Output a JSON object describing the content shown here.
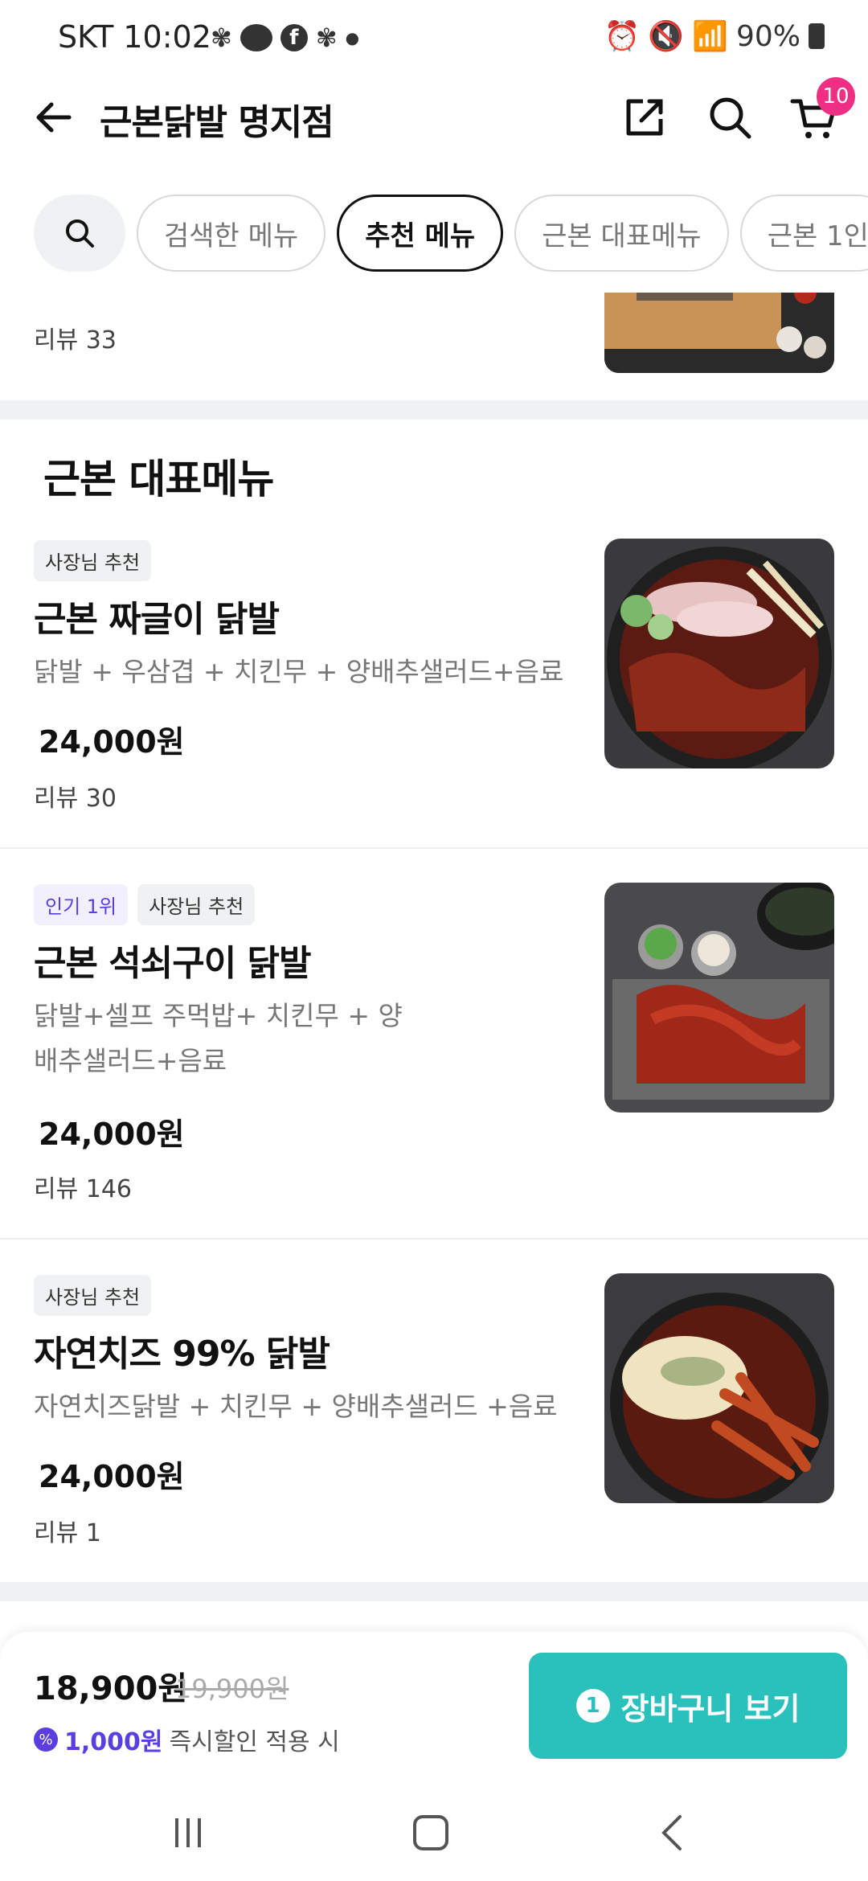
{
  "status_bar": {
    "time": "SKT 10:02",
    "talk_label": "TALK",
    "battery": "90%"
  },
  "header": {
    "title": "근본닭발 명지점",
    "cart_count": "10"
  },
  "tabs": [
    {
      "label": "검색한 메뉴",
      "active": false
    },
    {
      "label": "추천 메뉴",
      "active": true
    },
    {
      "label": "근본 대표메뉴",
      "active": false
    },
    {
      "label": "근본 1인",
      "active": false
    }
  ],
  "partial_item": {
    "review": "리뷰 33"
  },
  "section": {
    "title": "근본 대표메뉴"
  },
  "menu_items": [
    {
      "badges": [
        {
          "label": "사장님 추천",
          "type": "owner"
        }
      ],
      "name": "근본 짜글이 닭발",
      "desc": "닭발 + 우삼겹 + 치킨무 + 양배추샐러드+음료",
      "price": "24,000원",
      "review": "리뷰 30"
    },
    {
      "badges": [
        {
          "label": "인기 1위",
          "type": "popular"
        },
        {
          "label": "사장님 추천",
          "type": "owner"
        }
      ],
      "name": "근본 석쇠구이 닭발",
      "desc": "닭발+셀프 주먹밥+ 치킨무 + 양배추샐러드+음료",
      "price": "24,000원",
      "review": "리뷰 146"
    },
    {
      "badges": [
        {
          "label": "사장님 추천",
          "type": "owner"
        }
      ],
      "name": "자연치즈 99% 닭발",
      "desc": "자연치즈닭발 + 치킨무 + 양배추샐러드 +음료",
      "price": "24,000원",
      "review": "리뷰 1"
    }
  ],
  "cart_bar": {
    "total": "18,900원",
    "original": "19,900원",
    "discount_amount": "1,000원",
    "discount_text": "즉시할인 적용 시",
    "button_count": "1",
    "button_label": "장바구니 보기"
  },
  "colors": {
    "accent": "#2ac1bc",
    "badge_pink": "#ee2f84",
    "discount_purple": "#5a3ee0"
  }
}
